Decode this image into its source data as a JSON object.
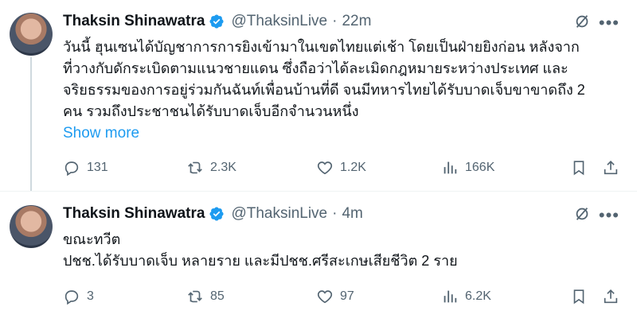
{
  "tweets": [
    {
      "author_name": "Thaksin Shinawatra",
      "handle": "@ThaksinLive",
      "separator": "·",
      "time": "22m",
      "body_lines": [
        "วันนี้ ฮุนเซนได้บัญชาการการยิงเข้ามาในเขตไทยแต่เช้า โดยเป็นฝ่ายยิงก่อน หลังจาก",
        "ที่วางกับดักระเบิดตามแนวชายแดน ซึ่งถือว่าได้ละเมิดกฎหมายระหว่างประเทศ และ",
        "จริยธรรมของการอยู่ร่วมกันฉันท์เพื่อนบ้านที่ดี จนมีทหารไทยได้รับบาดเจ็บขาขาดถึง 2",
        "คน รวมถึงประชาชนได้รับบาดเจ็บอีกจำนวนหนึ่ง"
      ],
      "show_more": "Show more",
      "stats": {
        "replies": "131",
        "reposts": "2.3K",
        "likes": "1.2K",
        "views": "166K"
      }
    },
    {
      "author_name": "Thaksin Shinawatra",
      "handle": "@ThaksinLive",
      "separator": "·",
      "time": "4m",
      "body_lines": [
        "ขณะทวีต",
        "ปชช.ได้รับบาดเจ็บ หลายราย และมีปชช.ศรีสะเกษเสียชีวิต 2 ราย"
      ],
      "stats": {
        "replies": "3",
        "reposts": "85",
        "likes": "97",
        "views": "6.2K"
      }
    }
  ],
  "icons": {
    "verified": "verified-badge-icon",
    "grok": "grok-icon",
    "more": "more-horizontal-icon",
    "reply": "reply-icon",
    "repost": "repost-icon",
    "like": "heart-icon",
    "views": "views-chart-icon",
    "bookmark": "bookmark-icon",
    "share": "share-icon"
  },
  "colors": {
    "text": "#0f1419",
    "secondary": "#536471",
    "accent": "#1d9bf0",
    "divider": "#eff3f4"
  }
}
